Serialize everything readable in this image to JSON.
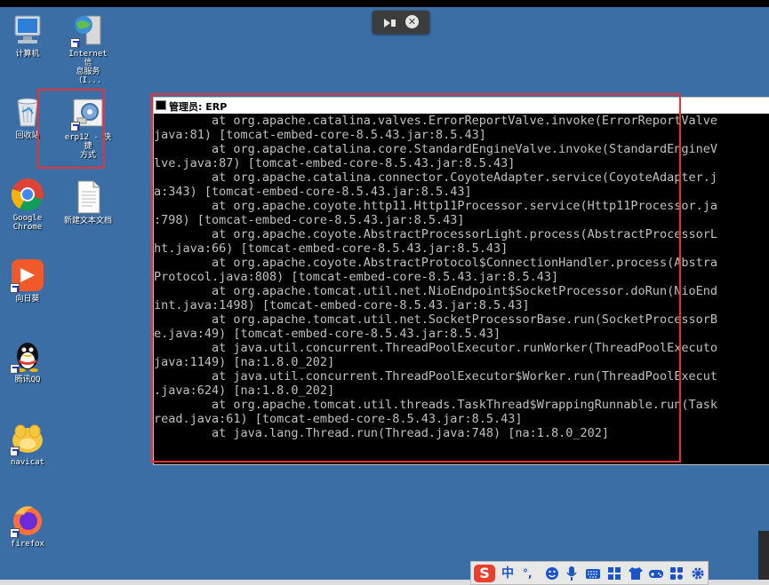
{
  "desktop": {
    "icons": [
      {
        "name": "computer",
        "label": "计算机"
      },
      {
        "name": "iis",
        "label": "Internet 信\n息服务（I..."
      },
      {
        "name": "recycle-bin",
        "label": "回收站"
      },
      {
        "name": "erp12-shortcut",
        "label": "erp12 - 快捷\n方式"
      },
      {
        "name": "chrome",
        "label": "Google\nChrome"
      },
      {
        "name": "new-text-doc",
        "label": "新建文本文档"
      },
      {
        "name": "sunflower",
        "label": "向日葵"
      },
      {
        "name": "qq",
        "label": "腾讯QQ"
      },
      {
        "name": "navicat",
        "label": "navicat"
      },
      {
        "name": "firefox",
        "label": "firefox"
      }
    ]
  },
  "cmd_window": {
    "title": "管理员:  ERP",
    "lines": [
      "        at org.apache.catalina.valves.ErrorReportValve.invoke(ErrorReportValve",
      "java:81) [tomcat-embed-core-8.5.43.jar:8.5.43]",
      "        at org.apache.catalina.core.StandardEngineValve.invoke(StandardEngineV",
      "lve.java:87) [tomcat-embed-core-8.5.43.jar:8.5.43]",
      "        at org.apache.catalina.connector.CoyoteAdapter.service(CoyoteAdapter.j",
      "a:343) [tomcat-embed-core-8.5.43.jar:8.5.43]",
      "        at org.apache.coyote.http11.Http11Processor.service(Http11Processor.ja",
      ":798) [tomcat-embed-core-8.5.43.jar:8.5.43]",
      "        at org.apache.coyote.AbstractProcessorLight.process(AbstractProcessorL",
      "ht.java:66) [tomcat-embed-core-8.5.43.jar:8.5.43]",
      "        at org.apache.coyote.AbstractProtocol$ConnectionHandler.process(Abstra",
      "Protocol.java:808) [tomcat-embed-core-8.5.43.jar:8.5.43]",
      "        at org.apache.tomcat.util.net.NioEndpoint$SocketProcessor.doRun(NioEnd",
      "int.java:1498) [tomcat-embed-core-8.5.43.jar:8.5.43]",
      "        at org.apache.tomcat.util.net.SocketProcessorBase.run(SocketProcessorB",
      "e.java:49) [tomcat-embed-core-8.5.43.jar:8.5.43]",
      "        at java.util.concurrent.ThreadPoolExecutor.runWorker(ThreadPoolExecuto",
      "java:1149) [na:1.8.0_202]",
      "        at java.util.concurrent.ThreadPoolExecutor$Worker.run(ThreadPoolExecut",
      ".java:624) [na:1.8.0_202]",
      "        at org.apache.tomcat.util.threads.TaskThread$WrappingRunnable.run(Task",
      "read.java:61) [tomcat-embed-core-8.5.43.jar:8.5.43]",
      "        at java.lang.Thread.run(Thread.java:748) [na:1.8.0_202]"
    ]
  },
  "ime": {
    "logo": "S",
    "lang": "中",
    "punct": "°,"
  },
  "colors": {
    "desktop_bg": "#3a6ea5",
    "highlight": "#e5333a",
    "console_text": "#c0c0c0"
  }
}
